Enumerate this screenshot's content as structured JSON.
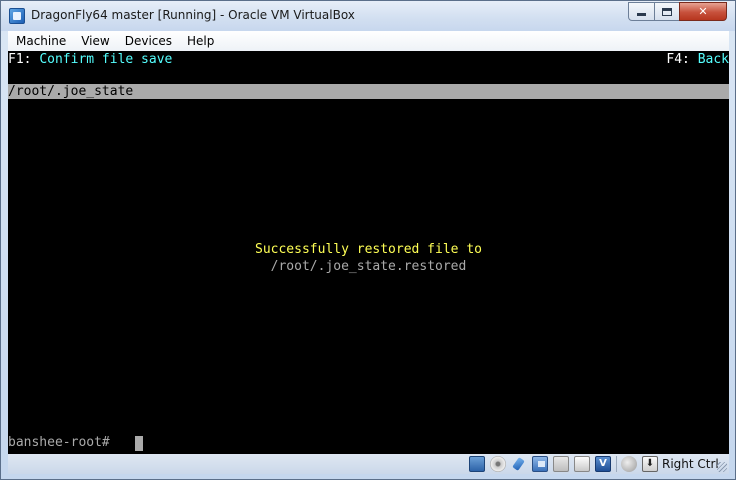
{
  "window": {
    "title": "DragonFly64 master [Running] - Oracle VM VirtualBox"
  },
  "menubar": {
    "items": [
      "Machine",
      "View",
      "Devices",
      "Help"
    ]
  },
  "screen": {
    "f1_key": "F1:",
    "f1_label": "Confirm file save",
    "f4_key": "F4:",
    "f4_label": "Back",
    "path": "/root/.joe_state",
    "message_line1": "Successfully restored file to",
    "message_line2": "/root/.joe_state.restored",
    "prompt": "banshee-root#"
  },
  "statusbar": {
    "icons": [
      "hard-disk-icon",
      "optical-drive-icon",
      "usb-icon",
      "network-icon",
      "shared-folders-icon",
      "display-icon",
      "hardware-virtualization-icon",
      "mouse-integration-icon",
      "host-key-icon"
    ],
    "host_key_label": "Right Ctrl"
  },
  "colors": {
    "screen_bg": "#000000",
    "label_cyan": "#55ffff",
    "message_yellow": "#ffff55",
    "text_gray": "#aaaaaa",
    "pathbar_bg": "#aaaaaa"
  }
}
